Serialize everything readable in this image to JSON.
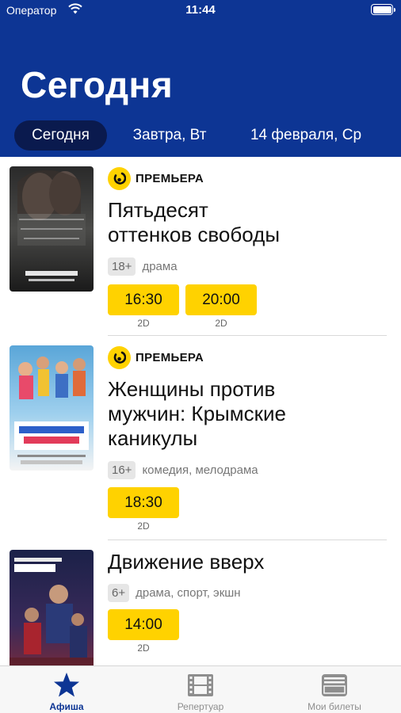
{
  "status_bar": {
    "carrier": "Оператор",
    "time": "11:44"
  },
  "header": {
    "title": "Сегодня"
  },
  "day_tabs": [
    {
      "label": "Сегодня",
      "active": true
    },
    {
      "label": "Завтра, Вт",
      "active": false
    },
    {
      "label": "14 февраля, Ср",
      "active": false
    }
  ],
  "movies": [
    {
      "badge": "ПРЕМЬЕРА",
      "title_lines": [
        "Пятьдесят",
        "оттенков свободы"
      ],
      "age": "18+",
      "genre": "драма",
      "sessions": [
        {
          "time": "16:30",
          "format": "2D"
        },
        {
          "time": "20:00",
          "format": "2D"
        }
      ]
    },
    {
      "badge": "ПРЕМЬЕРА",
      "title_lines": [
        "Женщины против",
        "мужчин: Крымские",
        "каникулы"
      ],
      "age": "16+",
      "genre": "комедия, мелодрама",
      "sessions": [
        {
          "time": "18:30",
          "format": "2D"
        }
      ]
    },
    {
      "badge": "",
      "title_lines": [
        "Движение вверх"
      ],
      "age": "6+",
      "genre": "драма, спорт, экшн",
      "sessions": [
        {
          "time": "14:00",
          "format": "2D"
        }
      ]
    }
  ],
  "tab_bar": [
    {
      "label": "Афиша",
      "icon": "star-icon",
      "active": true
    },
    {
      "label": "Репертуар",
      "icon": "film-icon",
      "active": false
    },
    {
      "label": "Мои билеты",
      "icon": "tickets-icon",
      "active": false
    }
  ],
  "colors": {
    "header": "#0d3594",
    "active_tab": "#0a1a4e",
    "accent": "#ffd200",
    "tab_active": "#0d3594"
  }
}
